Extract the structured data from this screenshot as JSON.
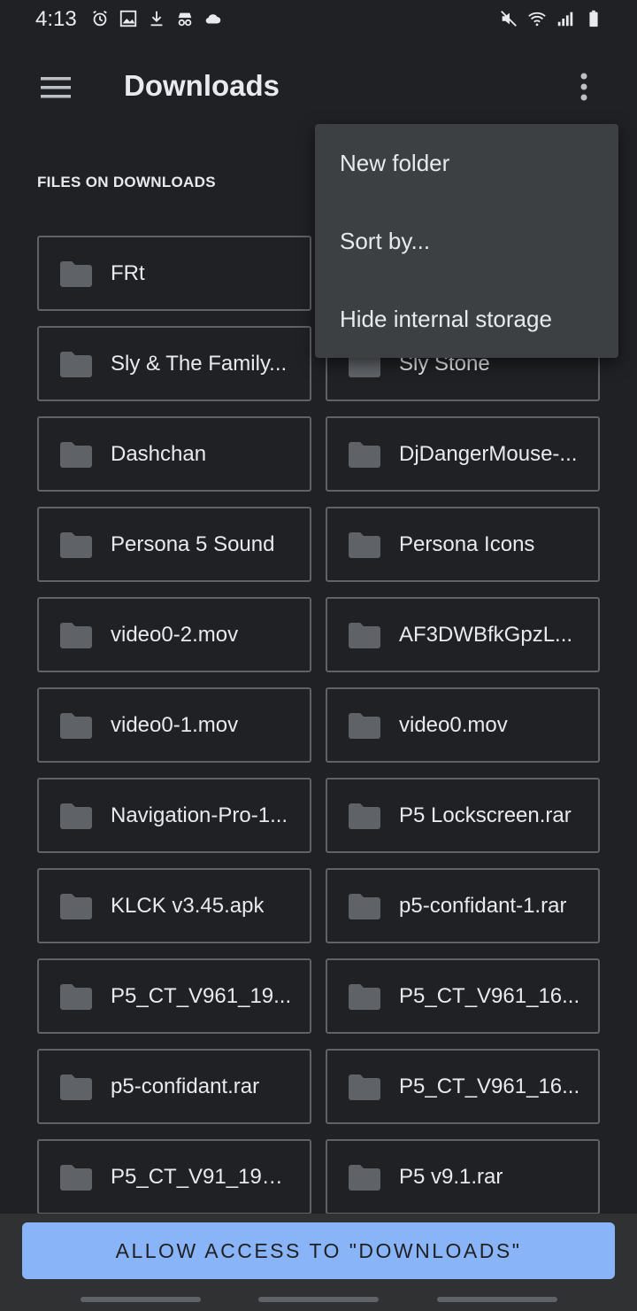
{
  "status_bar": {
    "time": "4:13",
    "left_icons": [
      "alarm-icon",
      "image-icon",
      "download-icon",
      "incognito-icon",
      "cloud-icon"
    ],
    "right_icons": [
      "mute-icon",
      "wifi-icon",
      "signal-icon",
      "battery-icon"
    ]
  },
  "app_bar": {
    "title": "Downloads",
    "menu_icon": "hamburger-menu-icon",
    "overflow_icon": "more-vert-icon"
  },
  "section_label": "FILES ON DOWNLOADS",
  "files": [
    "FRt",
    "",
    "Sly & The Family...",
    "Sly Stone",
    "Dashchan",
    "DjDangerMouse-...",
    "Persona 5 Sound",
    "Persona Icons",
    "video0-2.mov",
    "AF3DWBfkGpzL...",
    "video0-1.mov",
    "video0.mov",
    "Navigation-Pro-1...",
    "P5 Lockscreen.rar",
    "KLCK v3.45.apk",
    "p5-confidant-1.rar",
    "P5_CT_V961_19...",
    "P5_CT_V961_16...",
    "p5-confidant.rar",
    "P5_CT_V961_16...",
    "P5_CT_V91_199....",
    "P5 v9.1.rar"
  ],
  "overflow_menu": {
    "items": [
      "New folder",
      "Sort by...",
      "Hide internal storage"
    ]
  },
  "bottom": {
    "allow_button": "ALLOW ACCESS TO \"DOWNLOADS\""
  },
  "colors": {
    "background": "#202124",
    "accent": "#8ab4f8",
    "popup": "#3c4043",
    "tile_border": "#5f6368"
  }
}
